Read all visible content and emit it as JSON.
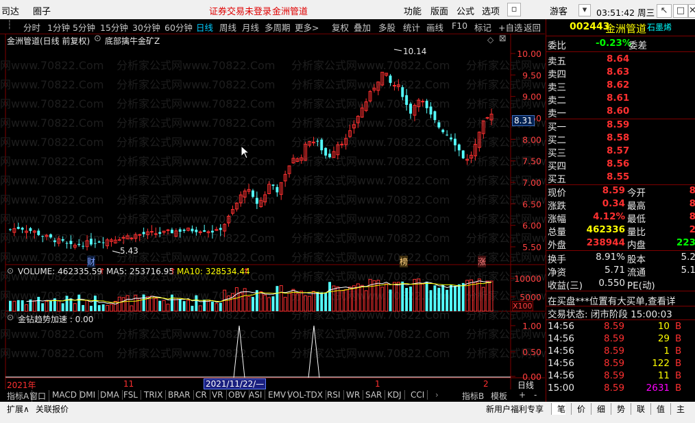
{
  "titlebar": {
    "app_name": "司达",
    "menu_circle": "圈子",
    "login_notice": "证券交易未登录",
    "stock_name": "金洲管道",
    "menus": [
      "功能",
      "版面",
      "公式",
      "选项"
    ],
    "user": "游客",
    "clock": "03:51:42 周三",
    "win_buttons": [
      "↖",
      "□",
      "✕"
    ]
  },
  "toolbar": {
    "periods": [
      "分时",
      "1分钟",
      "5分钟",
      "15分钟",
      "30分钟",
      "60分钟",
      "日线",
      "周线",
      "月线",
      "多周期",
      "更多>"
    ],
    "active_period": "日线",
    "actions": [
      "复权",
      "叠加",
      "多股",
      "统计",
      "画线",
      "F10",
      "标记",
      "+自选",
      "返回"
    ]
  },
  "chart": {
    "header_title": "金洲管道(日线 前复权)",
    "formula_name": "底部擒牛金矿Z",
    "price_axis": [
      "10.00",
      "9.50",
      "9.00",
      "8.50",
      "8.00",
      "7.50",
      "7.00",
      "6.50",
      "6.00",
      "5.50"
    ],
    "current_price_tag": "8.31",
    "high_label": "10.14",
    "low_label": "5.43",
    "markers": {
      "cai": "财",
      "bang": "榜",
      "zhang": "涨"
    },
    "volume_label": "VOLUME: 462335.59",
    "ma5_label": "MA5: 253716.95",
    "ma10_label": "MA10: 328534.44",
    "volume_axis": [
      "10000",
      "5000"
    ],
    "volume_unit": "X100",
    "indicator_label": "金钻趋势加速 : 0.00",
    "indicator_axis": [
      "1.00",
      "0.50",
      "0.00"
    ],
    "date_axis": {
      "year": "2021年",
      "m11": "11",
      "cursor_date": "2021/11/22/—",
      "m1": "1",
      "m2": "2",
      "period": "日线"
    },
    "watermark": "分析家公式网www.70822.Com",
    "colors": {
      "up": "#ff3030",
      "down": "#54ffff",
      "ma5": "#ffffff",
      "ma10": "#ffff00"
    }
  },
  "quote": {
    "code": "002443",
    "name": "金洲管道",
    "brand": "石墨烯",
    "weibi_label": "委比",
    "weibi_value": "-0.23%",
    "weicha_label": "委差",
    "asks": [
      {
        "label": "卖五",
        "price": "8.64"
      },
      {
        "label": "卖四",
        "price": "8.63"
      },
      {
        "label": "卖三",
        "price": "8.62"
      },
      {
        "label": "卖二",
        "price": "8.61"
      },
      {
        "label": "卖一",
        "price": "8.60"
      }
    ],
    "bids": [
      {
        "label": "买一",
        "price": "8.59"
      },
      {
        "label": "买二",
        "price": "8.58"
      },
      {
        "label": "买三",
        "price": "8.57"
      },
      {
        "label": "买四",
        "price": "8.56"
      },
      {
        "label": "买五",
        "price": "8.55"
      }
    ],
    "stats_left": [
      {
        "label": "现价",
        "value": "8.59"
      },
      {
        "label": "涨跌",
        "value": "0.34"
      },
      {
        "label": "涨幅",
        "value": "4.12%"
      },
      {
        "label": "总量",
        "value": "462336"
      },
      {
        "label": "外盘",
        "value": "238944"
      }
    ],
    "stats_right": [
      {
        "label": "今开",
        "value": "8"
      },
      {
        "label": "最高",
        "value": "8"
      },
      {
        "label": "最低",
        "value": "8"
      },
      {
        "label": "量比",
        "value": "2"
      },
      {
        "label": "内盘",
        "value": "223"
      }
    ],
    "stats2": [
      {
        "label": "换手",
        "value": "8.91%",
        "label2": "股本",
        "value2": "5.2"
      },
      {
        "label": "净资",
        "value": "5.71",
        "label2": "流通",
        "value2": "5.1"
      },
      {
        "label": "收益(三)",
        "value": "0.550",
        "label2": "PE(动)",
        "value2": ""
      }
    ],
    "notice": "在买盘***位置有大买单,查看详",
    "trade_status": "交易状态: 闭市阶段 15:00:03",
    "ticks": [
      {
        "time": "14:56",
        "price": "8.59",
        "vol": "10",
        "bs": "B"
      },
      {
        "time": "14:56",
        "price": "8.59",
        "vol": "29",
        "bs": "B"
      },
      {
        "time": "14:56",
        "price": "8.59",
        "vol": "1",
        "bs": "B"
      },
      {
        "time": "14:56",
        "price": "8.59",
        "vol": "122",
        "bs": "B"
      },
      {
        "time": "14:56",
        "price": "8.59",
        "vol": "11",
        "bs": "B"
      },
      {
        "time": "15:00",
        "price": "8.59",
        "vol": "2631",
        "bs": "B"
      }
    ]
  },
  "indicator_tabs": [
    "指标A",
    "窗口",
    "MACD",
    "DMI",
    "DMA",
    "FSL",
    "TRIX",
    "BRAR",
    "CR",
    "VR",
    "OBV",
    "ASI",
    "EMV",
    "VOL-TDX",
    "RSI",
    "WR",
    "SAR",
    "KDJ",
    "CCI"
  ],
  "indicator_tabs_right": [
    "指标B",
    "模板",
    "+",
    "-"
  ],
  "statusbar": {
    "left": [
      "扩展∧",
      "关联报价"
    ],
    "right_notice": "新用户福利专享",
    "right_tabs": [
      "笔",
      "价",
      "细",
      "势",
      "联",
      "值",
      "主"
    ]
  }
}
